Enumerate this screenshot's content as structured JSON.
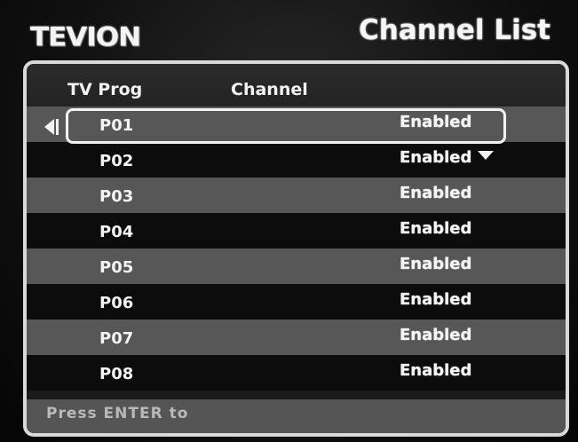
{
  "header": {
    "logo": "TEVION",
    "title": "Channel List"
  },
  "table": {
    "columns": [
      "TV Prog",
      "Channel"
    ],
    "selected_index": 0,
    "rows": [
      {
        "prog": "P01",
        "status": "Enabled"
      },
      {
        "prog": "P02",
        "status": "Enabled"
      },
      {
        "prog": "P03",
        "status": "Enabled"
      },
      {
        "prog": "P04",
        "status": "Enabled"
      },
      {
        "prog": "P05",
        "status": "Enabled"
      },
      {
        "prog": "P06",
        "status": "Enabled"
      },
      {
        "prog": "P07",
        "status": "Enabled"
      },
      {
        "prog": "P08",
        "status": "Enabled"
      }
    ]
  },
  "footer": {
    "hint": "Press ENTER to"
  },
  "icons": {
    "left": "left-arrow-icon",
    "down": "down-arrow-icon"
  }
}
